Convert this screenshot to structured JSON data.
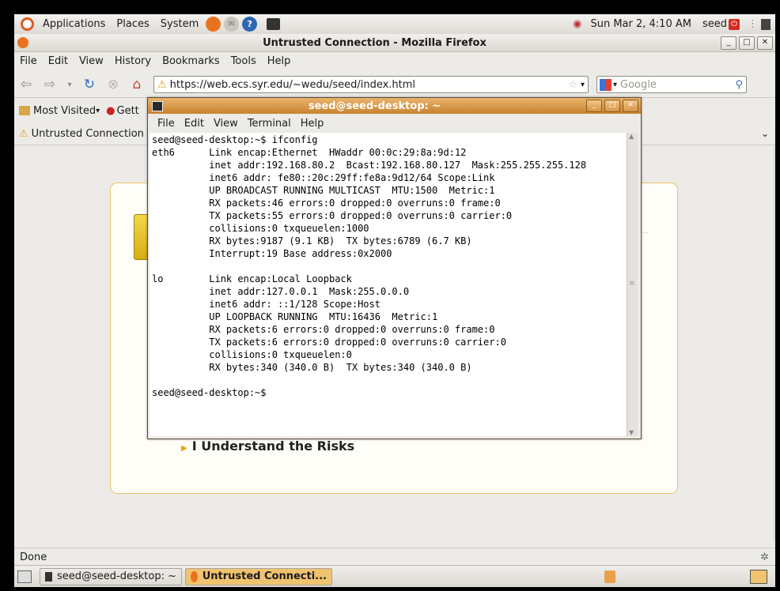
{
  "top_panel": {
    "menus": [
      "Applications",
      "Places",
      "System"
    ],
    "clock": "Sun Mar  2,  4:10 AM",
    "user": "seed"
  },
  "firefox": {
    "title": "Untrusted Connection - Mozilla Firefox",
    "menus": [
      "File",
      "Edit",
      "View",
      "History",
      "Bookmarks",
      "Tools",
      "Help"
    ],
    "url": "https://web.ecs.syr.edu/~wedu/seed/index.html",
    "search_placeholder": "Google",
    "bookmarks": [
      "Most Visited",
      "Gett"
    ],
    "tab_label": "Untrusted Connection",
    "risks_label": "I Understand the Risks",
    "status": "Done"
  },
  "terminal": {
    "title": "seed@seed-desktop: ~",
    "menus": [
      "File",
      "Edit",
      "View",
      "Terminal",
      "Help"
    ],
    "lines": [
      "seed@seed-desktop:~$ ifconfig",
      "eth6      Link encap:Ethernet  HWaddr 00:0c:29:8a:9d:12",
      "          inet addr:192.168.80.2  Bcast:192.168.80.127  Mask:255.255.255.128",
      "          inet6 addr: fe80::20c:29ff:fe8a:9d12/64 Scope:Link",
      "          UP BROADCAST RUNNING MULTICAST  MTU:1500  Metric:1",
      "          RX packets:46 errors:0 dropped:0 overruns:0 frame:0",
      "          TX packets:55 errors:0 dropped:0 overruns:0 carrier:0",
      "          collisions:0 txqueuelen:1000",
      "          RX bytes:9187 (9.1 KB)  TX bytes:6789 (6.7 KB)",
      "          Interrupt:19 Base address:0x2000",
      "",
      "lo        Link encap:Local Loopback",
      "          inet addr:127.0.0.1  Mask:255.0.0.0",
      "          inet6 addr: ::1/128 Scope:Host",
      "          UP LOOPBACK RUNNING  MTU:16436  Metric:1",
      "          RX packets:6 errors:0 dropped:0 overruns:0 frame:0",
      "          TX packets:6 errors:0 dropped:0 overruns:0 carrier:0",
      "          collisions:0 txqueuelen:0",
      "          RX bytes:340 (340.0 B)  TX bytes:340 (340.0 B)",
      "",
      "seed@seed-desktop:~$ "
    ]
  },
  "taskbar": {
    "items": [
      "seed@seed-desktop: ~",
      "Untrusted Connecti..."
    ]
  },
  "icons": {
    "ubuntu": "ubuntu-logo-icon",
    "warning": "warning-icon",
    "back": "back-arrow-icon",
    "forward": "forward-arrow-icon",
    "reload": "reload-icon",
    "stop": "stop-icon",
    "home": "home-icon",
    "star": "bookmark-star-icon",
    "search": "magnifier-icon"
  },
  "colors": {
    "terminal_title": "#d18f3f",
    "warning_border": "#e7c46a",
    "risks_arrow": "#e8a40c"
  }
}
